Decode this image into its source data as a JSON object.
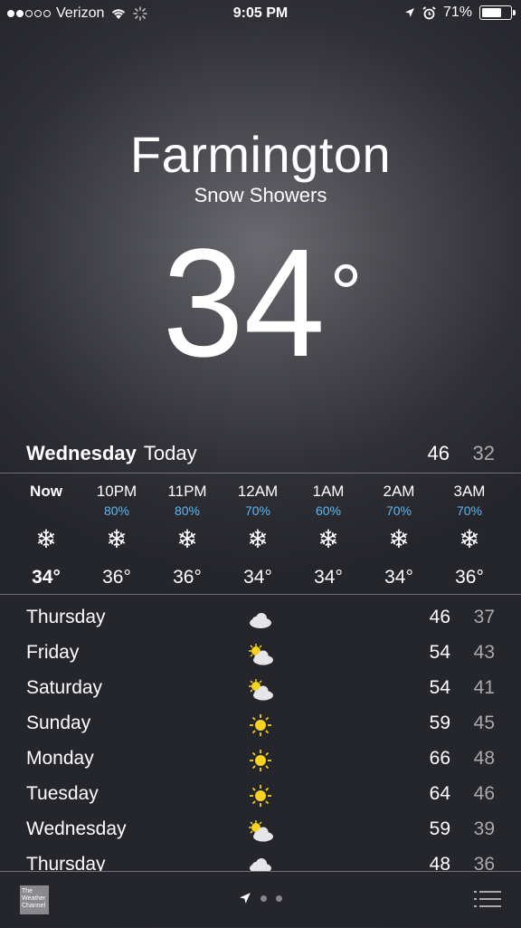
{
  "status_bar": {
    "carrier": "Verizon",
    "time": "9:05 PM",
    "battery": "71%",
    "battery_level": 0.71
  },
  "location": {
    "city": "Farmington",
    "condition": "Snow Showers",
    "temperature": "34",
    "degree": "°"
  },
  "today": {
    "day": "Wednesday",
    "label": "Today",
    "high": "46",
    "low": "32"
  },
  "hourly": [
    {
      "time": "Now",
      "precip": "",
      "icon": "snowflake-icon",
      "temp": "34°"
    },
    {
      "time": "10PM",
      "precip": "80%",
      "icon": "snowflake-icon",
      "temp": "36°"
    },
    {
      "time": "11PM",
      "precip": "80%",
      "icon": "snowflake-icon",
      "temp": "36°"
    },
    {
      "time": "12AM",
      "precip": "70%",
      "icon": "snowflake-icon",
      "temp": "34°"
    },
    {
      "time": "1AM",
      "precip": "60%",
      "icon": "snowflake-icon",
      "temp": "34°"
    },
    {
      "time": "2AM",
      "precip": "70%",
      "icon": "snowflake-icon",
      "temp": "34°"
    },
    {
      "time": "3AM",
      "precip": "70%",
      "icon": "snowflake-icon",
      "temp": "36°"
    }
  ],
  "daily": [
    {
      "day": "Thursday",
      "icon": "cloud",
      "high": "46",
      "low": "37"
    },
    {
      "day": "Friday",
      "icon": "partly-sunny",
      "high": "54",
      "low": "43"
    },
    {
      "day": "Saturday",
      "icon": "partly-sunny",
      "high": "54",
      "low": "41"
    },
    {
      "day": "Sunday",
      "icon": "sun",
      "high": "59",
      "low": "45"
    },
    {
      "day": "Monday",
      "icon": "sun",
      "high": "66",
      "low": "48"
    },
    {
      "day": "Tuesday",
      "icon": "sun",
      "high": "64",
      "low": "46"
    },
    {
      "day": "Wednesday",
      "icon": "partly-sunny",
      "high": "59",
      "low": "39"
    },
    {
      "day": "Thursday",
      "icon": "cloud-rain",
      "high": "48",
      "low": "36"
    }
  ],
  "bottom": {
    "logo_text": "The Weather Channel"
  },
  "colors": {
    "precip": "#5db8ef",
    "sun": "#f7d21e",
    "cloud": "#e6e6ea",
    "low_temp": "#aaaaaa"
  }
}
